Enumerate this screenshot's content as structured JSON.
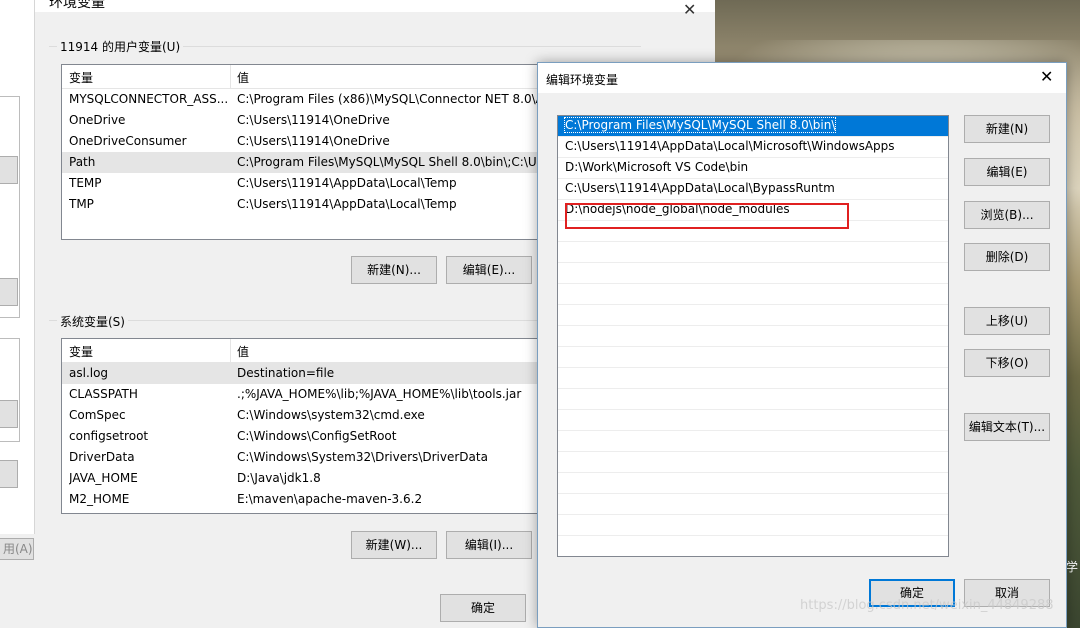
{
  "background": {
    "side_text": "学"
  },
  "left_window": {
    "apply_label": "用(A)"
  },
  "env_dialog": {
    "title": "环境变量",
    "user_vars": {
      "group_label": "11914 的用户变量(U)",
      "columns": [
        "变量",
        "值"
      ],
      "rows": [
        {
          "name": "MYSQLCONNECTOR_ASS...",
          "value": "C:\\Program Files (x86)\\MySQL\\Connector NET 8.0\\A"
        },
        {
          "name": "OneDrive",
          "value": "C:\\Users\\11914\\OneDrive"
        },
        {
          "name": "OneDriveConsumer",
          "value": "C:\\Users\\11914\\OneDrive"
        },
        {
          "name": "Path",
          "value": "C:\\Program Files\\MySQL\\MySQL Shell 8.0\\bin\\;C:\\Us"
        },
        {
          "name": "TEMP",
          "value": "C:\\Users\\11914\\AppData\\Local\\Temp"
        },
        {
          "name": "TMP",
          "value": "C:\\Users\\11914\\AppData\\Local\\Temp"
        }
      ],
      "new_label": "新建(N)...",
      "edit_label": "编辑(E)..."
    },
    "system_vars": {
      "group_label": "系统变量(S)",
      "columns": [
        "变量",
        "值"
      ],
      "rows": [
        {
          "name": "asl.log",
          "value": "Destination=file"
        },
        {
          "name": "CLASSPATH",
          "value": ".;%JAVA_HOME%\\lib;%JAVA_HOME%\\lib\\tools.jar"
        },
        {
          "name": "ComSpec",
          "value": "C:\\Windows\\system32\\cmd.exe"
        },
        {
          "name": "configsetroot",
          "value": "C:\\Windows\\ConfigSetRoot"
        },
        {
          "name": "DriverData",
          "value": "C:\\Windows\\System32\\Drivers\\DriverData"
        },
        {
          "name": "JAVA_HOME",
          "value": "D:\\Java\\jdk1.8"
        },
        {
          "name": "M2_HOME",
          "value": "E:\\maven\\apache-maven-3.6.2"
        }
      ],
      "new_label": "新建(W)...",
      "edit_label": "编辑(I)..."
    },
    "ok_label": "确定"
  },
  "edit_dialog": {
    "title": "编辑环境变量",
    "paths": [
      "C:\\Program Files\\MySQL\\MySQL Shell 8.0\\bin\\",
      "C:\\Users\\11914\\AppData\\Local\\Microsoft\\WindowsApps",
      "D:\\Work\\Microsoft VS Code\\bin",
      "C:\\Users\\11914\\AppData\\Local\\BypassRuntm",
      "D:\\nodejs\\node_global\\node_modules"
    ],
    "selected_index": 0,
    "buttons": {
      "new": "新建(N)",
      "edit": "编辑(E)",
      "browse": "浏览(B)...",
      "delete": "删除(D)",
      "move_up": "上移(U)",
      "move_down": "下移(O)",
      "edit_text": "编辑文本(T)..."
    },
    "ok_label": "确定",
    "cancel_label": "取消"
  },
  "watermark": "https://blog.csdn.net/weixin_44849288",
  "colors": {
    "selection": "#0078d7",
    "highlight_box": "#e02020"
  }
}
